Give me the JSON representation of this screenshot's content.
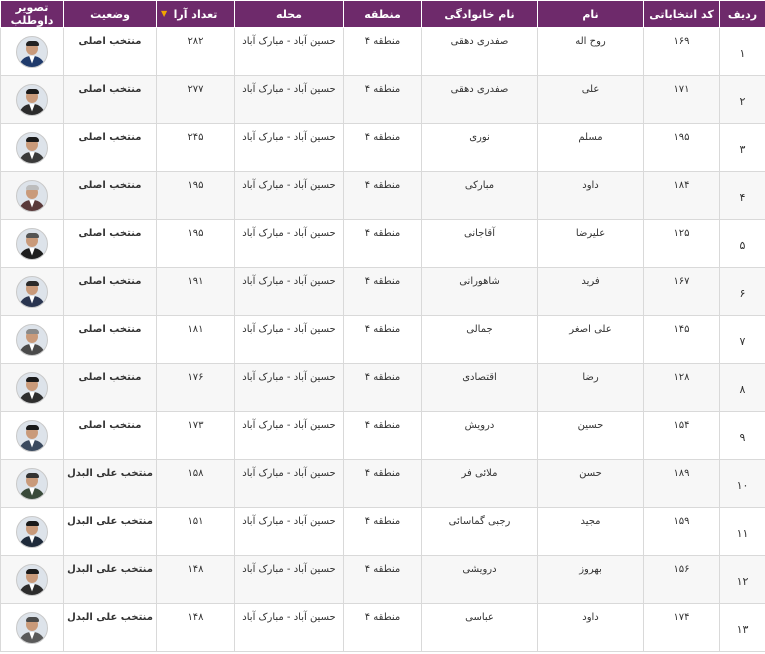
{
  "table": {
    "headers": {
      "row": "ردیف",
      "code": "کد انتخاباتی",
      "first_name": "نام",
      "last_name": "نام خانوادگی",
      "region": "منطقه",
      "neighborhood": "محله",
      "votes": "تعداد آرا",
      "status": "وضعیت",
      "photo": "تصویر داوطلب"
    },
    "sort_indicator": "▼",
    "rows": [
      {
        "row": "۱",
        "code": "۱۶۹",
        "first_name": "روح اله",
        "last_name": "صفدری دهقی",
        "region": "منطقه ۴",
        "neighborhood": "حسین آباد - مبارک آباد",
        "votes": "۲۸۲",
        "status": "منتخب اصلی",
        "status_type": "main",
        "suit": "#1f3a6b",
        "hair": "#222222"
      },
      {
        "row": "۲",
        "code": "۱۷۱",
        "first_name": "علی",
        "last_name": "صفدری دهقی",
        "region": "منطقه ۴",
        "neighborhood": "حسین آباد - مبارک آباد",
        "votes": "۲۷۷",
        "status": "منتخب اصلی",
        "status_type": "main",
        "suit": "#2b2b2b",
        "hair": "#1a1a1a"
      },
      {
        "row": "۳",
        "code": "۱۹۵",
        "first_name": "مسلم",
        "last_name": "نوری",
        "region": "منطقه ۴",
        "neighborhood": "حسین آباد - مبارک آباد",
        "votes": "۲۴۵",
        "status": "منتخب اصلی",
        "status_type": "main",
        "suit": "#3a3a3a",
        "hair": "#1a1a1a"
      },
      {
        "row": "۴",
        "code": "۱۸۴",
        "first_name": "داود",
        "last_name": "مبارکی",
        "region": "منطقه ۴",
        "neighborhood": "حسین آباد - مبارک آباد",
        "votes": "۱۹۵",
        "status": "منتخب اصلی",
        "status_type": "main",
        "suit": "#5a3a3a",
        "hair": "#bdbdbd"
      },
      {
        "row": "۵",
        "code": "۱۲۵",
        "first_name": "علیرضا",
        "last_name": "آقاجانی",
        "region": "منطقه ۴",
        "neighborhood": "حسین آباد - مبارک آباد",
        "votes": "۱۹۵",
        "status": "منتخب اصلی",
        "status_type": "main",
        "suit": "#1e1e1e",
        "hair": "#555555"
      },
      {
        "row": "۶",
        "code": "۱۶۷",
        "first_name": "فرید",
        "last_name": "شاهورانی",
        "region": "منطقه ۴",
        "neighborhood": "حسین آباد - مبارک آباد",
        "votes": "۱۹۱",
        "status": "منتخب اصلی",
        "status_type": "main",
        "suit": "#2a3550",
        "hair": "#2a2a2a"
      },
      {
        "row": "۷",
        "code": "۱۴۵",
        "first_name": "علی اصغر",
        "last_name": "جمالی",
        "region": "منطقه ۴",
        "neighborhood": "حسین آباد - مبارک آباد",
        "votes": "۱۸۱",
        "status": "منتخب اصلی",
        "status_type": "main",
        "suit": "#4a4a4a",
        "hair": "#8a8a8a"
      },
      {
        "row": "۸",
        "code": "۱۲۸",
        "first_name": "رضا",
        "last_name": "اقتصادی",
        "region": "منطقه ۴",
        "neighborhood": "حسین آباد - مبارک آباد",
        "votes": "۱۷۶",
        "status": "منتخب اصلی",
        "status_type": "main",
        "suit": "#2e2e2e",
        "hair": "#1a1a1a"
      },
      {
        "row": "۹",
        "code": "۱۵۴",
        "first_name": "حسین",
        "last_name": "درویش",
        "region": "منطقه ۴",
        "neighborhood": "حسین آباد - مبارک آباد",
        "votes": "۱۷۳",
        "status": "منتخب اصلی",
        "status_type": "main",
        "suit": "#3b4a5e",
        "hair": "#1a1a1a"
      },
      {
        "row": "۱۰",
        "code": "۱۸۹",
        "first_name": "حسن",
        "last_name": "ملائی فر",
        "region": "منطقه ۴",
        "neighborhood": "حسین آباد - مبارک آباد",
        "votes": "۱۵۸",
        "status": "منتخب علی البدل",
        "status_type": "alt",
        "suit": "#3a4a3a",
        "hair": "#333333"
      },
      {
        "row": "۱۱",
        "code": "۱۵۹",
        "first_name": "مجید",
        "last_name": "رجبی گماسائی",
        "region": "منطقه ۴",
        "neighborhood": "حسین آباد - مبارک آباد",
        "votes": "۱۵۱",
        "status": "منتخب علی البدل",
        "status_type": "alt",
        "suit": "#1e2a3a",
        "hair": "#1a1a1a"
      },
      {
        "row": "۱۲",
        "code": "۱۵۶",
        "first_name": "بهروز",
        "last_name": "درویشی",
        "region": "منطقه ۴",
        "neighborhood": "حسین آباد - مبارک آباد",
        "votes": "۱۴۸",
        "status": "منتخب علی البدل",
        "status_type": "alt",
        "suit": "#2c2c2c",
        "hair": "#1a1a1a"
      },
      {
        "row": "۱۳",
        "code": "۱۷۴",
        "first_name": "داود",
        "last_name": "عباسی",
        "region": "منطقه ۴",
        "neighborhood": "حسین آباد - مبارک آباد",
        "votes": "۱۴۸",
        "status": "منتخب علی البدل",
        "status_type": "alt",
        "suit": "#5a5a5a",
        "hair": "#4a4a4a"
      }
    ]
  },
  "colors": {
    "header_bg": "#6e2a6b",
    "status_main": "#1a9e1a",
    "status_alt": "#3aa0e0",
    "sort_arrow": "#f0a500"
  }
}
